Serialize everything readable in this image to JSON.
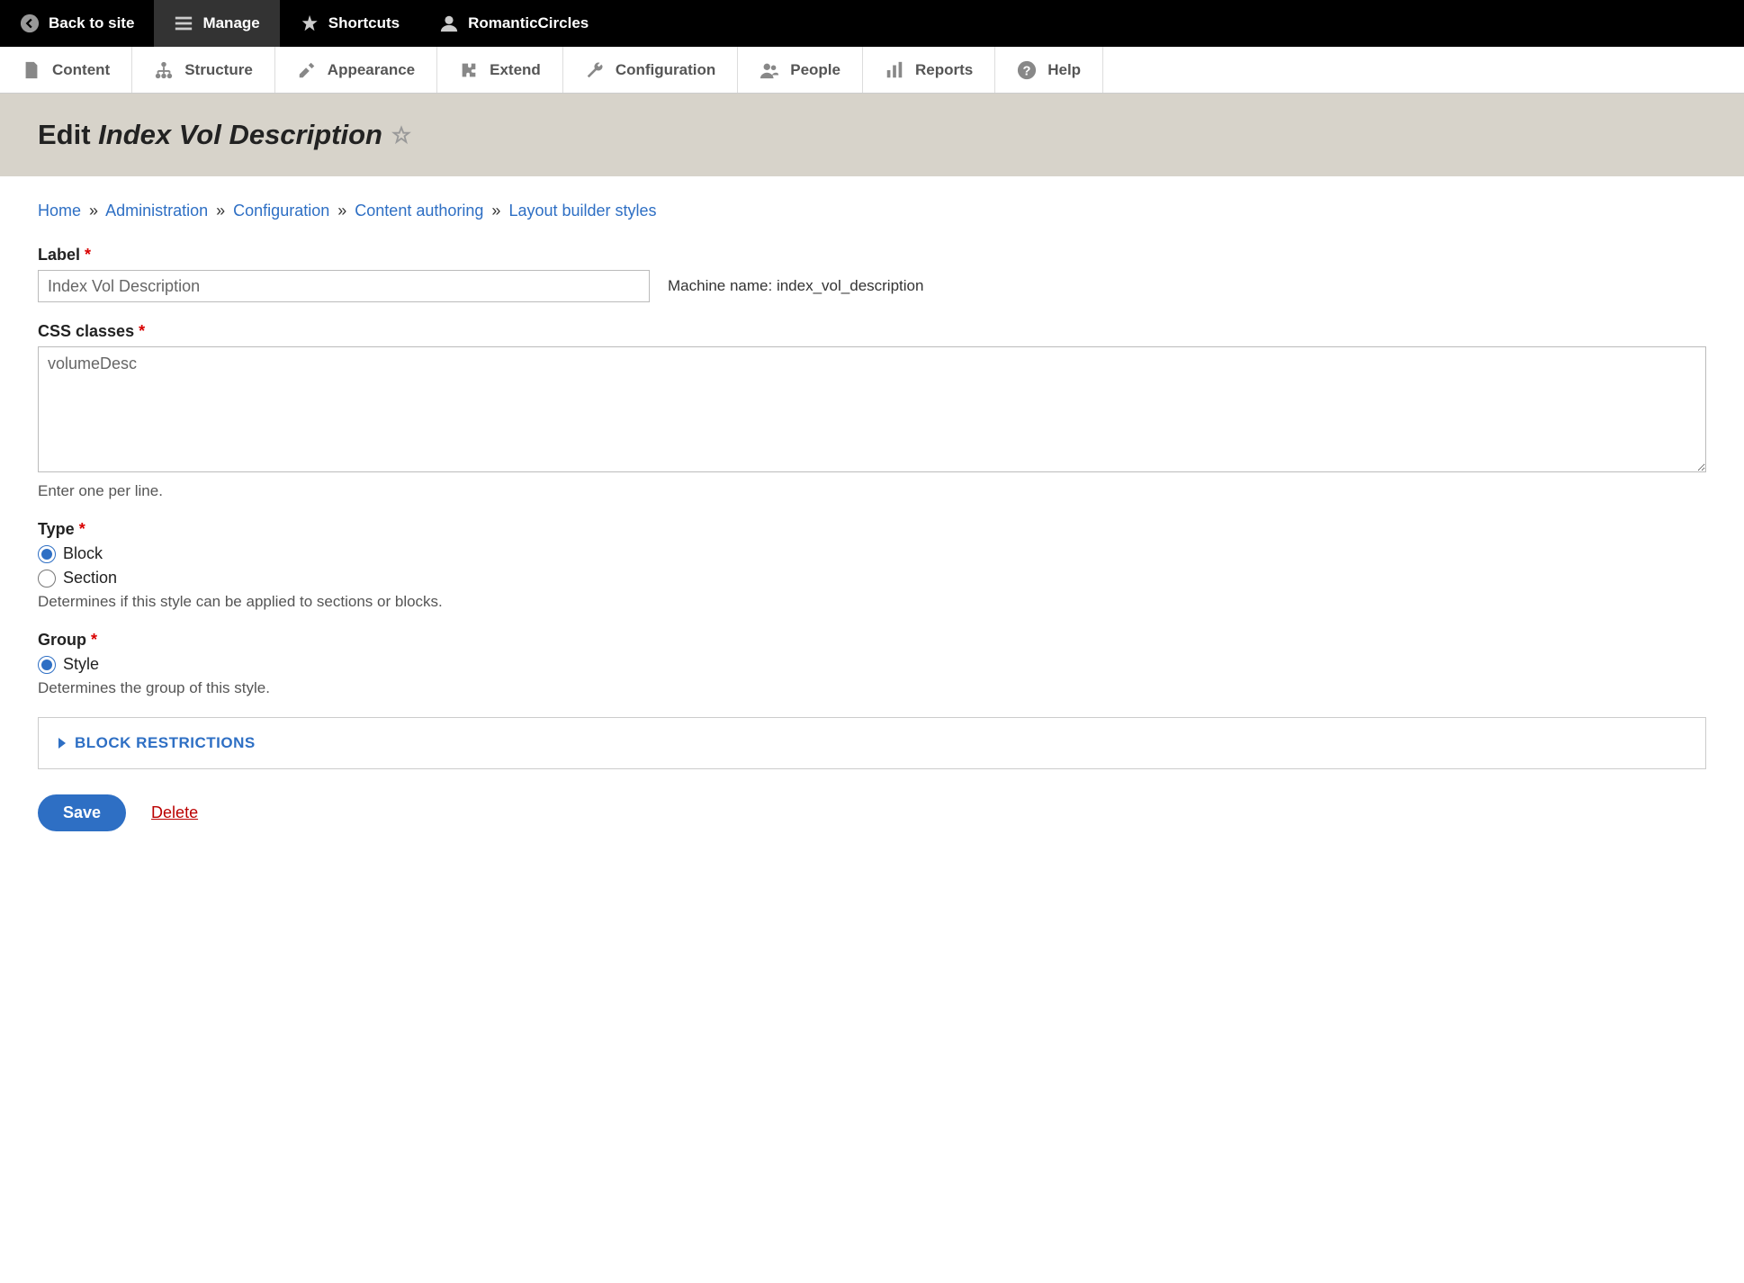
{
  "toolbar_top": {
    "back": "Back to site",
    "manage": "Manage",
    "shortcuts": "Shortcuts",
    "user": "RomanticCircles"
  },
  "toolbar_admin": {
    "content": "Content",
    "structure": "Structure",
    "appearance": "Appearance",
    "extend": "Extend",
    "configuration": "Configuration",
    "people": "People",
    "reports": "Reports",
    "help": "Help"
  },
  "page_title": {
    "prefix": "Edit ",
    "title": "Index Vol Description"
  },
  "breadcrumb": {
    "home": "Home",
    "admin": "Administration",
    "config": "Configuration",
    "content_auth": "Content authoring",
    "lbs": "Layout builder styles"
  },
  "form": {
    "label_label": "Label",
    "label_value": "Index Vol Description",
    "machine_prefix": "Machine name: ",
    "machine_name": "index_vol_description",
    "css_label": "CSS classes",
    "css_value": "volumeDesc",
    "css_desc": "Enter one per line.",
    "type_label": "Type",
    "type_block": "Block",
    "type_section": "Section",
    "type_desc": "Determines if this style can be applied to sections or blocks.",
    "group_label": "Group",
    "group_style": "Style",
    "group_desc": "Determines the group of this style.",
    "block_restrictions": "BLOCK RESTRICTIONS",
    "save": "Save",
    "delete": "Delete"
  }
}
